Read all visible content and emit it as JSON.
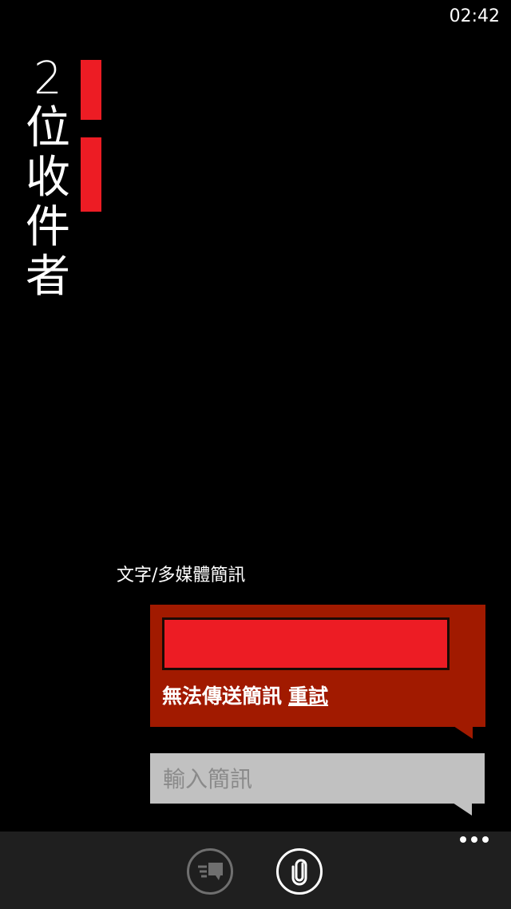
{
  "status_bar": {
    "time": "02:42"
  },
  "header": {
    "title_chars": [
      "2",
      "位",
      "收",
      "件",
      "者"
    ]
  },
  "conversation": {
    "message_type_label": "文字/多媒體簡訊",
    "sent_message": {
      "status_text": "無法傳送簡訊",
      "retry_label": "重試"
    },
    "compose": {
      "placeholder": "輸入簡訊",
      "value": ""
    }
  },
  "app_bar": {
    "buttons": [
      {
        "icon": "voice-to-text-icon"
      },
      {
        "icon": "paperclip-icon"
      }
    ],
    "more_icon": "ellipsis-icon"
  },
  "colors": {
    "accent_red": "#ed1c24",
    "error_bubble": "#a11a00",
    "compose_bg": "#c1c1c1",
    "appbar_bg": "#1f1f1f"
  }
}
